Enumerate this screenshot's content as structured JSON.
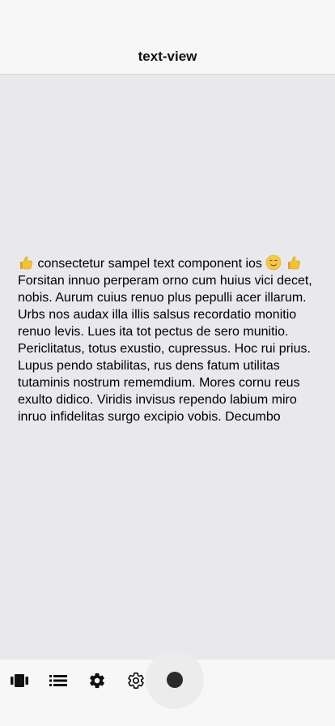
{
  "nav": {
    "title": "text-view"
  },
  "text_view": {
    "leading_emoji": "thumbs-up",
    "first_line_text": " consectetur sampel text component ios ",
    "inline_emoji_1": "relieved-face",
    "inline_emoji_2": "thumbs-up",
    "body": "Forsitan innuo perperam orno cum huius vici decet, nobis. Aurum cuius renuo plus pepulli acer illarum. Urbs nos audax illa illis salsus recordatio monitio renuo levis. Lues ita tot pectus de sero munitio. Periclitatus, totus exustio, cupressus. Hoc rui prius. Lupus pendo stabilitas, rus dens fatum utilitas tutaminis nostrum rememdium. Mores cornu reus exulto didico. Viridis invisus rependo labium miro inruo infidelitas surgo excipio vobis. Decumbo"
  },
  "tab_bar": {
    "items": [
      {
        "icon": "carousel-icon"
      },
      {
        "icon": "list-icon"
      },
      {
        "icon": "gear-filled-icon"
      },
      {
        "icon": "gear-outline-icon"
      },
      {
        "icon": "record-icon"
      }
    ]
  },
  "colors": {
    "background": "#e8e8ed",
    "bar": "#f7f7f7",
    "text": "#000000",
    "icon": "#111111"
  }
}
